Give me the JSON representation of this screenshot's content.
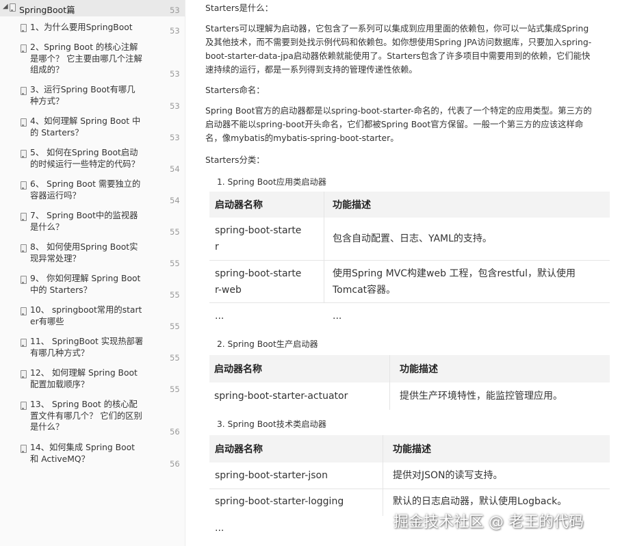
{
  "sidebar": {
    "root": {
      "label": "SpringBoot篇",
      "page": "53"
    },
    "items": [
      {
        "lines": [
          "1、为什么要用SpringBoot"
        ],
        "page": "53"
      },
      {
        "lines": [
          "2、Spring Boot 的核心注解",
          "是哪个？ 它主要由哪几个注解",
          "组成的？"
        ],
        "page": "53"
      },
      {
        "lines": [
          "3、运行Spring Boot有哪几",
          "种方式？"
        ],
        "page": "53"
      },
      {
        "lines": [
          "4、如何理解 Spring Boot 中",
          "的 Starters？"
        ],
        "page": "53"
      },
      {
        "lines": [
          "5、 如何在Spring Boot启动",
          "的时候运行一些特定的代码？"
        ],
        "page": "54"
      },
      {
        "lines": [
          "6、 Spring Boot 需要独立的",
          "容器运行吗？"
        ],
        "page": "54"
      },
      {
        "lines": [
          "7、 Spring Boot中的监视器",
          "是什么？"
        ],
        "page": "55"
      },
      {
        "lines": [
          "8、 如何使用Spring Boot实",
          "现异常处理？"
        ],
        "page": "55"
      },
      {
        "lines": [
          "9、 你如何理解 Spring Boot",
          "中的 Starters？"
        ],
        "page": "55"
      },
      {
        "lines": [
          "10、 springboot常用的start",
          "er有哪些"
        ],
        "page": "55"
      },
      {
        "lines": [
          "11、 SpringBoot 实现热部署",
          "有哪几种方式？"
        ],
        "page": "55"
      },
      {
        "lines": [
          "12、 如何理解 Spring Boot",
          "配置加载顺序？"
        ],
        "page": "55"
      },
      {
        "lines": [
          "13、 Spring Boot 的核心配",
          "置文件有哪几个？ 它们的区别",
          "是什么？"
        ],
        "page": "56"
      },
      {
        "lines": [
          "14、如何集成 Spring Boot",
          "和 ActiveMQ？"
        ],
        "page": "56"
      }
    ]
  },
  "content": {
    "h_what": "Starters是什么：",
    "p_what": [
      "Starters可以理解为启动器，它包含了一系列可以集成到应用里面的依赖包，你可以一站式集成Spring",
      "及其他技术，而不需要到处找示例代码和依赖包。如你想使用Spring JPA访问数据库，只要加入spring-",
      "boot-starter-data-jpa启动器依赖就能使用了。Starters包含了许多项目中需要用到的依赖，它们能快",
      "速持续的运行，都是一系列得到支持的管理传递性依赖。"
    ],
    "h_naming": "Starters命名：",
    "p_naming": [
      "Spring Boot官方的启动器都是以spring-boot-starter-命名的，代表了一个特定的应用类型。第三方的",
      "启动器不能以spring-boot开头命名，它们都被Spring Boot官方保留。一般一个第三方的应该这样命",
      "名，像mybatis的mybatis-spring-boot-starter。"
    ],
    "h_category": "Starters分类：",
    "sub1": "1. Spring Boot应用类启动器",
    "sub2": "2. Spring Boot生产启动器",
    "sub3": "3. Spring Boot技术类启动器",
    "t1": {
      "headers": [
        "启动器名称",
        "功能描述"
      ],
      "rows": [
        {
          "name": [
            "spring-boot-starte",
            "r"
          ],
          "desc": [
            "包含自动配置、日志、YAML的支持。"
          ]
        },
        {
          "name": [
            "spring-boot-starte",
            "r-web"
          ],
          "desc": [
            "使用Spring MVC构建web 工程，包含restful，默认使用",
            "Tomcat容器。"
          ]
        },
        {
          "name": [
            "..."
          ],
          "desc": [
            "..."
          ]
        }
      ]
    },
    "t2": {
      "headers": [
        "启动器名称",
        "功能描述"
      ],
      "rows": [
        {
          "name": [
            "spring-boot-starter-actuator"
          ],
          "desc": [
            "提供生产环境特性，能监控管理应用。"
          ]
        }
      ]
    },
    "t3": {
      "headers": [
        "启动器名称",
        "功能描述"
      ],
      "rows": [
        {
          "name": [
            "spring-boot-starter-json"
          ],
          "desc": [
            "提供对JSON的读写支持。"
          ]
        },
        {
          "name": [
            "spring-boot-starter-logging"
          ],
          "desc": [
            "默认的日志启动器，默认使用Logback。"
          ]
        },
        {
          "name": [
            "..."
          ],
          "desc": [
            ""
          ]
        }
      ]
    }
  },
  "watermark": "掘金技术社区 @ 老王的代码"
}
